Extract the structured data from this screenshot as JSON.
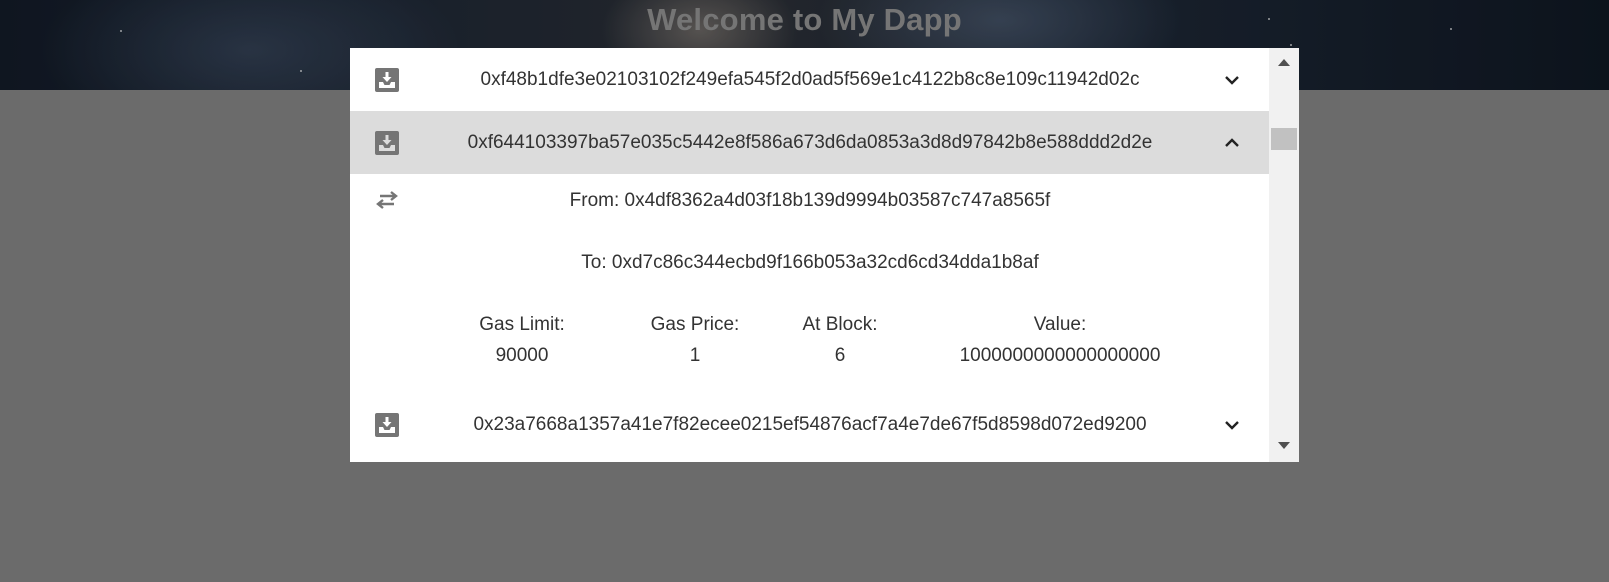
{
  "app": {
    "title": "Welcome to My Dapp"
  },
  "transactions": [
    {
      "hash": "0xf48b1dfe3e02103102f249efa545f2d0ad5f569e1c4122b8c8e109c11942d02c",
      "expanded": false
    },
    {
      "hash": "0xf644103397ba57e035c5442e8f586a673d6da0853a3d8d97842b8e588ddd2d2e",
      "expanded": true,
      "details": {
        "from": "From: 0x4df8362a4d03f18b139d9994b03587c747a8565f",
        "to": "To: 0xd7c86c344ecbd9f166b053a32cd6cd34dda1b8af",
        "gas_limit_label": "Gas Limit:",
        "gas_limit_value": "90000",
        "gas_price_label": "Gas Price:",
        "gas_price_value": "1",
        "at_block_label": "At Block:",
        "at_block_value": "6",
        "value_label": "Value:",
        "value_value": "1000000000000000000"
      }
    },
    {
      "hash": "0x23a7668a1357a41e7f82ecee0215ef54876acf7a4e7de67f5d8598d072ed9200",
      "expanded": false
    }
  ],
  "icons": {
    "transaction": "inbox-download-icon",
    "detail": "swap-arrows-icon",
    "collapsed": "chevron-down-icon",
    "expanded": "chevron-up-icon"
  },
  "colors": {
    "overlay": "#6b6b6b",
    "dialog_bg": "#ffffff",
    "expanded_row_bg": "#dcdcdc",
    "icon": "#757575",
    "text": "#333333",
    "scrollbar_track": "#f1f1f1",
    "scrollbar_thumb": "#c1c1c1"
  }
}
